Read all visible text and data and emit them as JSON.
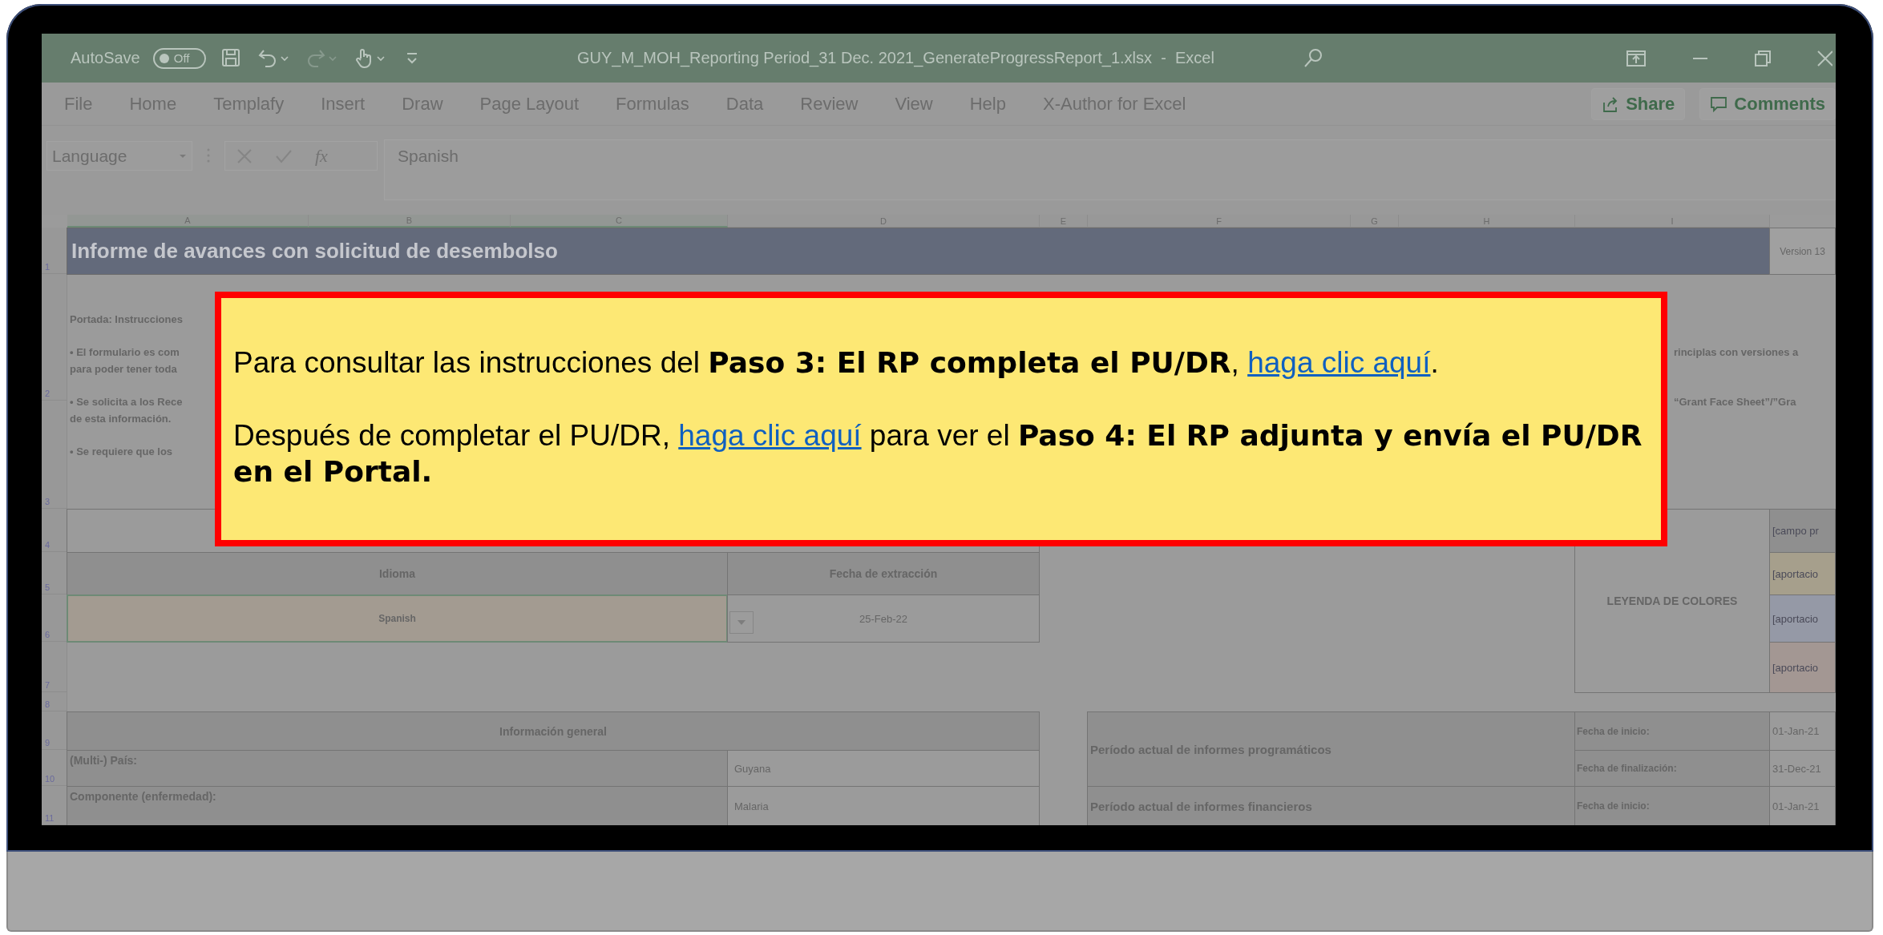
{
  "window": {
    "title": "GUY_M_MOH_Reporting Period_31 Dec. 2021_GenerateProgressReport_1.xlsx  -  Excel",
    "autosave": {
      "label": "AutoSave",
      "toggle_text": "Off",
      "on": false
    },
    "quick_access": [
      {
        "kind": "save",
        "disabled": false,
        "menu": false
      },
      {
        "kind": "undo",
        "disabled": false,
        "menu": true
      },
      {
        "kind": "redo",
        "disabled": true,
        "menu": true
      },
      {
        "kind": "touch",
        "disabled": false,
        "menu": true
      },
      {
        "kind": "customize",
        "disabled": false,
        "menu": false
      }
    ]
  },
  "menu": {
    "items": [
      "File",
      "Home",
      "Templafy",
      "Insert",
      "Draw",
      "Page Layout",
      "Formulas",
      "Data",
      "Review",
      "View",
      "Help",
      "X-Author for Excel"
    ],
    "share": "Share",
    "comments": "Comments"
  },
  "formula_bar": {
    "name_box": "Language",
    "function_label": "fx",
    "value": "Spanish"
  },
  "sheet": {
    "columns": [
      {
        "label": "A",
        "selected": true
      },
      {
        "label": "B",
        "selected": true
      },
      {
        "label": "C",
        "selected": true
      },
      {
        "label": "D",
        "selected": false
      },
      {
        "label": "E",
        "selected": false
      },
      {
        "label": "F",
        "selected": false
      },
      {
        "label": "G",
        "selected": false
      },
      {
        "label": "H",
        "selected": false
      },
      {
        "label": "I",
        "selected": false
      }
    ],
    "rows": [
      "1",
      "2",
      "3",
      "4",
      "5",
      "6",
      "7",
      "8",
      "9",
      "10",
      "11"
    ],
    "title": "Informe de avances con solicitud de desembolso",
    "version": "Version 13",
    "instructions": [
      {
        "lines": [
          "Portada: Instrucciones"
        ]
      },
      {
        "lines": [
          "• El formulario es com",
          "para poder tener toda"
        ],
        "right": "rinciplas con versiones a"
      },
      {
        "lines": [
          "• Se solicita a los Rece",
          "de esta información."
        ],
        "right": "“Grant Face Sheet”/”Gra"
      },
      {
        "lines": [
          "• Se requiere que los"
        ]
      }
    ],
    "legend": {
      "title": "LEYENDA DE COLORES",
      "items": [
        {
          "text": "[campo pr",
          "color": "#8f8f8f"
        },
        {
          "text": "[aportacio",
          "color": "#a69f8c"
        },
        {
          "text": "[aportacio",
          "color": "#9599a6"
        },
        {
          "text": "[aportacio",
          "color": "#a39793"
        }
      ]
    },
    "language": {
      "header": "Idioma",
      "value": "Spanish",
      "selected": true
    },
    "extraction": {
      "header": "Fecha de extracción",
      "value": "25-Feb-22"
    },
    "general": {
      "header": "Información general",
      "rows": [
        {
          "label": "(Multi-) País:",
          "value": "Guyana"
        },
        {
          "label": "Componente (enfermedad):",
          "value": "Malaria"
        }
      ]
    },
    "periods": [
      {
        "title": "Período actual de informes programáticos",
        "dates": [
          {
            "label": "Fecha de inicio:",
            "value": "01-Jan-21"
          },
          {
            "label": "Fecha de finalización:",
            "value": "31-Dec-21"
          }
        ]
      },
      {
        "title": "Período actual de informes financieros",
        "dates": [
          {
            "label": "Fecha de inicio:",
            "value": "01-Jan-21"
          }
        ]
      }
    ]
  },
  "callout": {
    "paragraphs": [
      [
        {
          "kind": "text",
          "text": "Para consultar las instrucciones del **Paso 3: El RP completa el PU/DR**, "
        },
        {
          "kind": "link",
          "text": "haga clic aquí"
        },
        {
          "kind": "text",
          "text": "."
        }
      ],
      [
        {
          "kind": "text",
          "text": "Después de completar el PU/DR, "
        },
        {
          "kind": "link",
          "text": "haga clic aquí"
        },
        {
          "kind": "text",
          "text": " para ver el **Paso 4: El RP adjunta y envía el PU/DR en el Portal.**"
        }
      ]
    ]
  }
}
